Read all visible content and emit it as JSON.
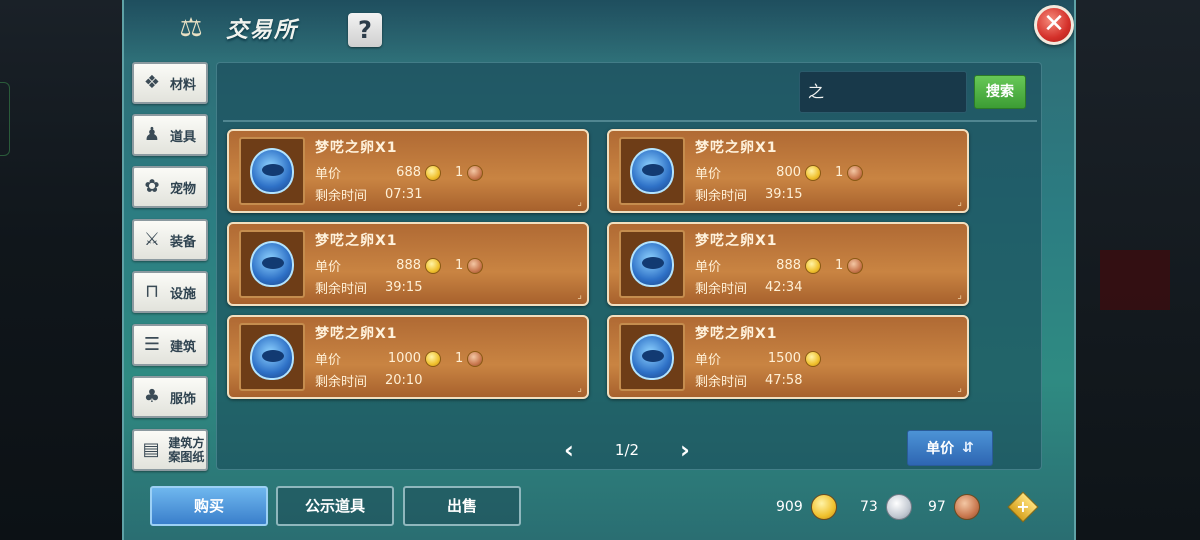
{
  "header": {
    "title": "交易所",
    "help_label": "?",
    "close_label": "✕"
  },
  "sidebar": {
    "items": [
      {
        "label": "材料",
        "icon": "materials-icon",
        "glyph": "❖"
      },
      {
        "label": "道具",
        "icon": "item-icon",
        "glyph": "♟"
      },
      {
        "label": "宠物",
        "icon": "paw-icon",
        "glyph": "✿"
      },
      {
        "label": "装备",
        "icon": "equipment-icon",
        "glyph": "⚔"
      },
      {
        "label": "设施",
        "icon": "facility-icon",
        "glyph": "⊓"
      },
      {
        "label": "建筑",
        "icon": "building-icon",
        "glyph": "☰"
      },
      {
        "label": "服饰",
        "icon": "clothing-icon",
        "glyph": "♣"
      },
      {
        "label": "建筑方案图纸",
        "icon": "blueprint-icon",
        "glyph": "▤"
      }
    ]
  },
  "search": {
    "value": "之",
    "button_label": "搜索"
  },
  "listing_labels": {
    "price_label": "单价",
    "time_label": "剩余时间"
  },
  "listings": [
    {
      "name": "梦呓之卵X1",
      "price": "688",
      "bronze": "1",
      "time": "07:31"
    },
    {
      "name": "梦呓之卵X1",
      "price": "800",
      "bronze": "1",
      "time": "39:15"
    },
    {
      "name": "梦呓之卵X1",
      "price": "888",
      "bronze": "1",
      "time": "39:15"
    },
    {
      "name": "梦呓之卵X1",
      "price": "888",
      "bronze": "1",
      "time": "42:34"
    },
    {
      "name": "梦呓之卵X1",
      "price": "1000",
      "bronze": "1",
      "time": "20:10"
    },
    {
      "name": "梦呓之卵X1",
      "price": "1500",
      "bronze": "",
      "time": "47:58"
    }
  ],
  "pager": {
    "prev": "‹",
    "page": "1/2",
    "next": "›"
  },
  "sort": {
    "label": "单价",
    "icon": "sort-icon"
  },
  "bottom": {
    "buy": "购买",
    "public_items": "公示道具",
    "sell": "出售"
  },
  "currency": {
    "gold": "909",
    "silver": "73",
    "bronze": "97",
    "add": "+"
  },
  "colors": {
    "card_bg": "#b06a34",
    "accent_green": "#3c9c34",
    "accent_blue": "#3a7fcb"
  }
}
